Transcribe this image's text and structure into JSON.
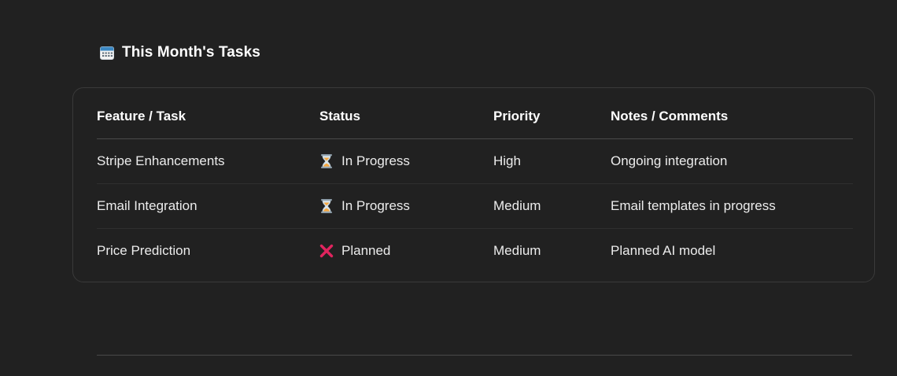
{
  "section": {
    "icon": "calendar-icon",
    "title": "This Month's Tasks"
  },
  "table": {
    "headers": [
      "Feature / Task",
      "Status",
      "Priority",
      "Notes / Comments"
    ],
    "rows": [
      {
        "task": "Stripe Enhancements",
        "status_icon": "hourglass-icon",
        "status": "In Progress",
        "priority": "High",
        "notes": "Ongoing integration"
      },
      {
        "task": "Email Integration",
        "status_icon": "hourglass-icon",
        "status": "In Progress",
        "priority": "Medium",
        "notes": "Email templates in progress"
      },
      {
        "task": "Price Prediction",
        "status_icon": "cross-mark-icon",
        "status": "Planned",
        "priority": "Medium",
        "notes": "Planned AI model"
      }
    ]
  },
  "colors": {
    "background": "#212121",
    "cross_mark": "#e0245e",
    "hourglass": "#f4a640"
  }
}
